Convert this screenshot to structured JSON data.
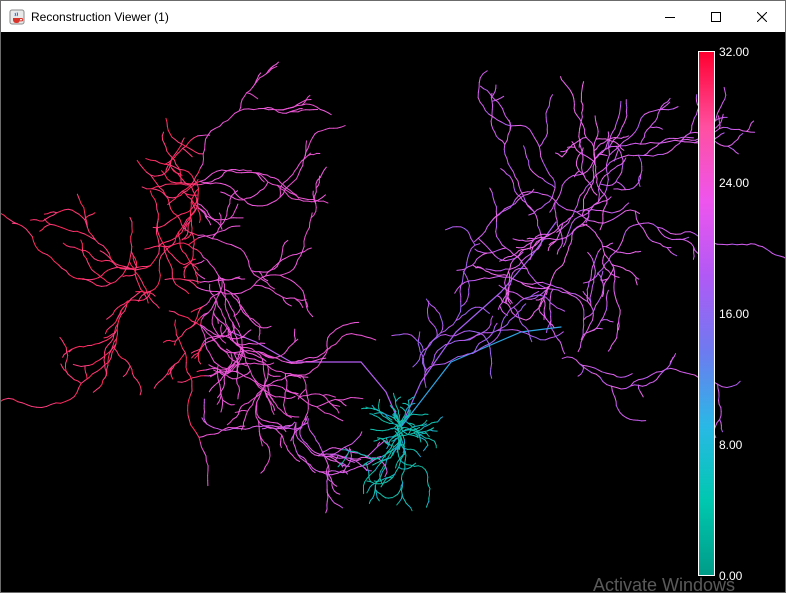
{
  "window": {
    "title": "Reconstruction Viewer (1)",
    "icon": "java-coffee-icon",
    "controls": [
      "minimize-icon",
      "maximize-icon",
      "close-icon"
    ]
  },
  "viewer": {
    "background": "#000000",
    "colorbar": {
      "min": 0,
      "max": 32,
      "tick_labels": [
        "32.00",
        "24.00",
        "16.00",
        "8.00",
        "0.00"
      ],
      "gradient": [
        "#FF0030",
        "#FF4FA0",
        "#EE55EE",
        "#B159F5",
        "#6E7AF0",
        "#2AB8E6",
        "#00C8B0",
        "#009C88"
      ]
    }
  },
  "watermark": "Activate Windows"
}
